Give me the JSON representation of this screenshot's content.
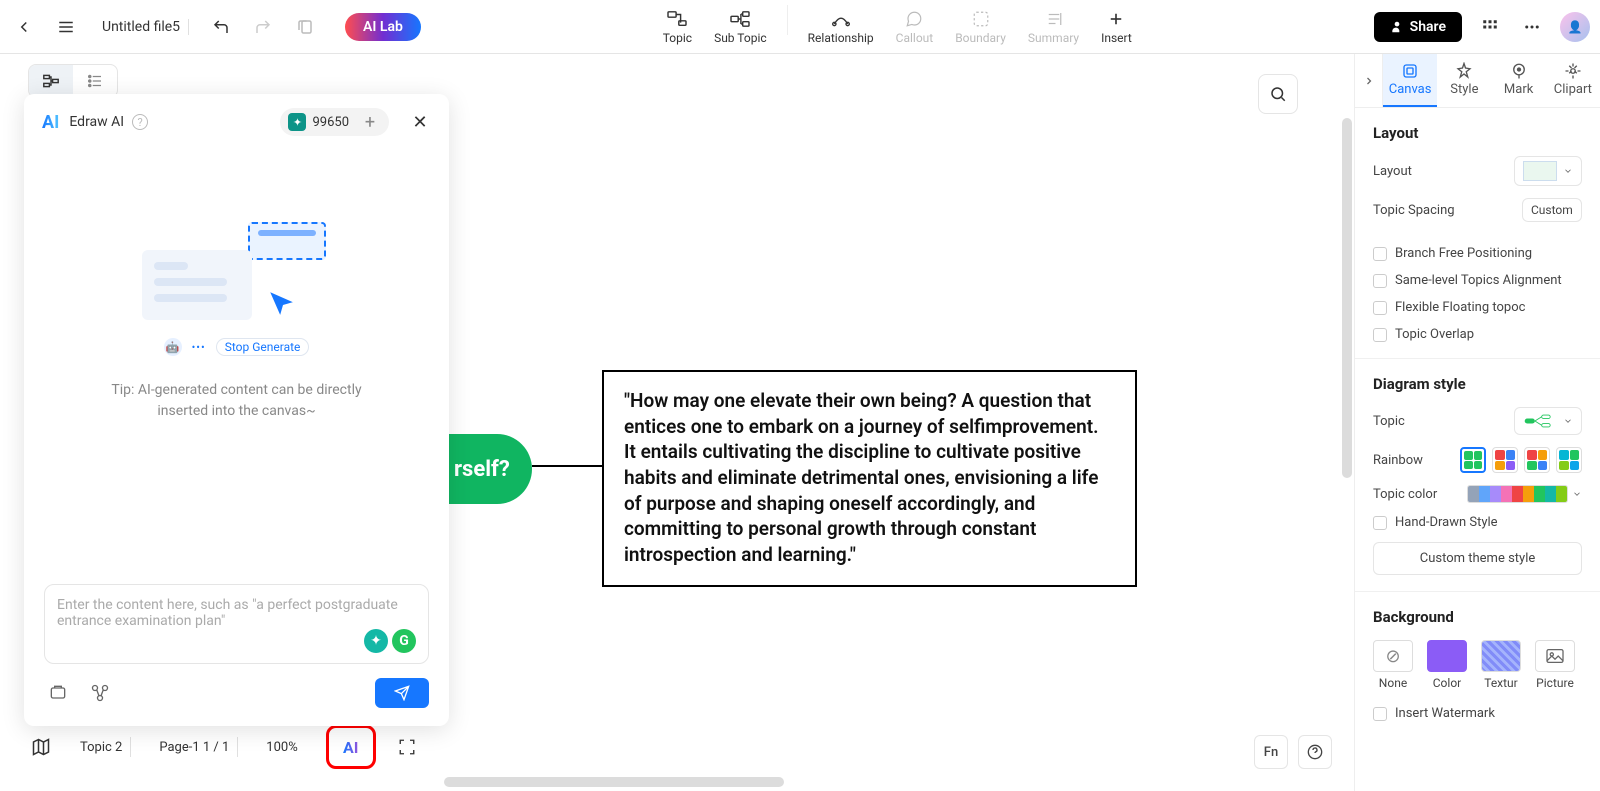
{
  "header": {
    "file_title": "Untitled file5",
    "ai_lab_label": "AI Lab",
    "share_label": "Share",
    "tools": [
      {
        "label": "Topic",
        "icon": "topic",
        "disabled": false
      },
      {
        "label": "Sub Topic",
        "icon": "subtopic",
        "disabled": false
      },
      {
        "label": "Relationship",
        "icon": "relationship",
        "disabled": false
      },
      {
        "label": "Callout",
        "icon": "callout",
        "disabled": true
      },
      {
        "label": "Boundary",
        "icon": "boundary",
        "disabled": true
      },
      {
        "label": "Summary",
        "icon": "summary",
        "disabled": true
      },
      {
        "label": "Insert",
        "icon": "insert",
        "disabled": false
      }
    ]
  },
  "ai_panel": {
    "title": "Edraw AI",
    "credits": "99650",
    "tip": "Tip: AI-generated content can be directly inserted into the canvas~",
    "stop_label": "Stop Generate",
    "placeholder": "Enter the content here, such as \"a perfect postgraduate entrance examination plan\""
  },
  "canvas": {
    "topic_fragment": "rself?",
    "text_content": "\"How may one elevate their own being?  A question that entices one to embark on a journey of selfimprovement. It entails cultivating the discipline to cultivate positive habits and eliminate detrimental ones, envisioning a life of purpose and shaping oneself accordingly, and committing to personal growth through constant introspection and learning.\""
  },
  "right_panel": {
    "tabs": [
      "Canvas",
      "Style",
      "Mark",
      "Clipart"
    ],
    "layout_section": {
      "title": "Layout",
      "layout_label": "Layout",
      "spacing_label": "Topic Spacing",
      "spacing_value": "Custom",
      "checks": [
        "Branch Free Positioning",
        "Same-level Topics Alignment",
        "Flexible Floating topoc",
        "Topic Overlap"
      ]
    },
    "diagram_section": {
      "title": "Diagram style",
      "topic_label": "Topic",
      "rainbow_label": "Rainbow",
      "color_label": "Topic color",
      "hand_label": "Hand-Drawn Style",
      "custom_btn": "Custom theme style"
    },
    "bg_section": {
      "title": "Background",
      "options": [
        "None",
        "Color",
        "Textur",
        "Picture"
      ],
      "watermark_label": "Insert Watermark"
    }
  },
  "bottom": {
    "topic_label": "Topic 2",
    "page_label": "Page-1  1 / 1",
    "zoom": "100%",
    "ai_label": "AI",
    "fn_label": "Fn"
  }
}
